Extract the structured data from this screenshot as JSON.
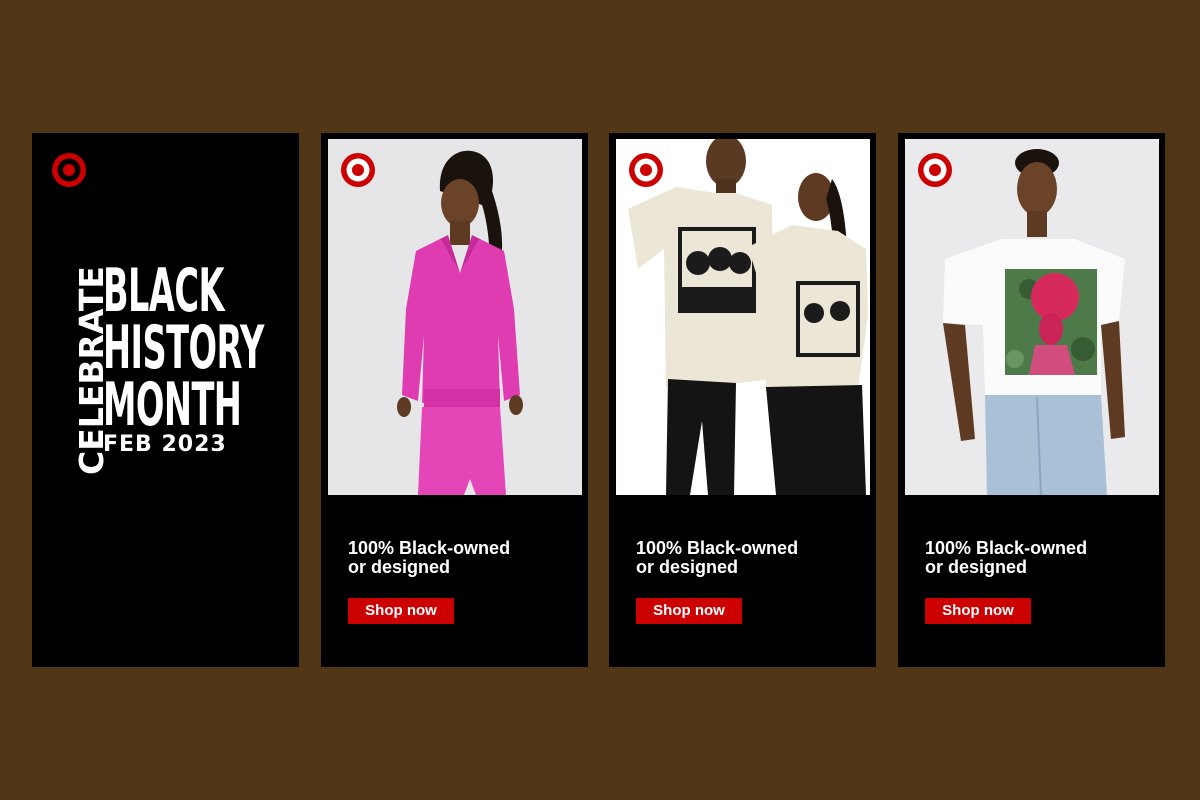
{
  "colors": {
    "background": "#513616",
    "panel": "#000000",
    "brand_red": "#cc0000",
    "text": "#ffffff"
  },
  "logo_icon": "target-bullseye-icon",
  "headline": {
    "celebrate": "CELEBRATE",
    "lines": [
      "BLACK",
      "HISTORY",
      "MONTH"
    ],
    "date": "FEB 2023"
  },
  "products": [
    {
      "caption_line1": "100% Black-owned",
      "caption_line2": "or designed",
      "button_label": "Shop now",
      "photo_description": "woman-in-pink-sweatshirt-and-skirt"
    },
    {
      "caption_line1": "100% Black-owned",
      "caption_line2": "or designed",
      "button_label": "Shop now",
      "photo_description": "couple-in-graphic-tees"
    },
    {
      "caption_line1": "100% Black-owned",
      "caption_line2": "or designed",
      "button_label": "Shop now",
      "photo_description": "woman-in-art-print-tee-and-jeans"
    }
  ]
}
